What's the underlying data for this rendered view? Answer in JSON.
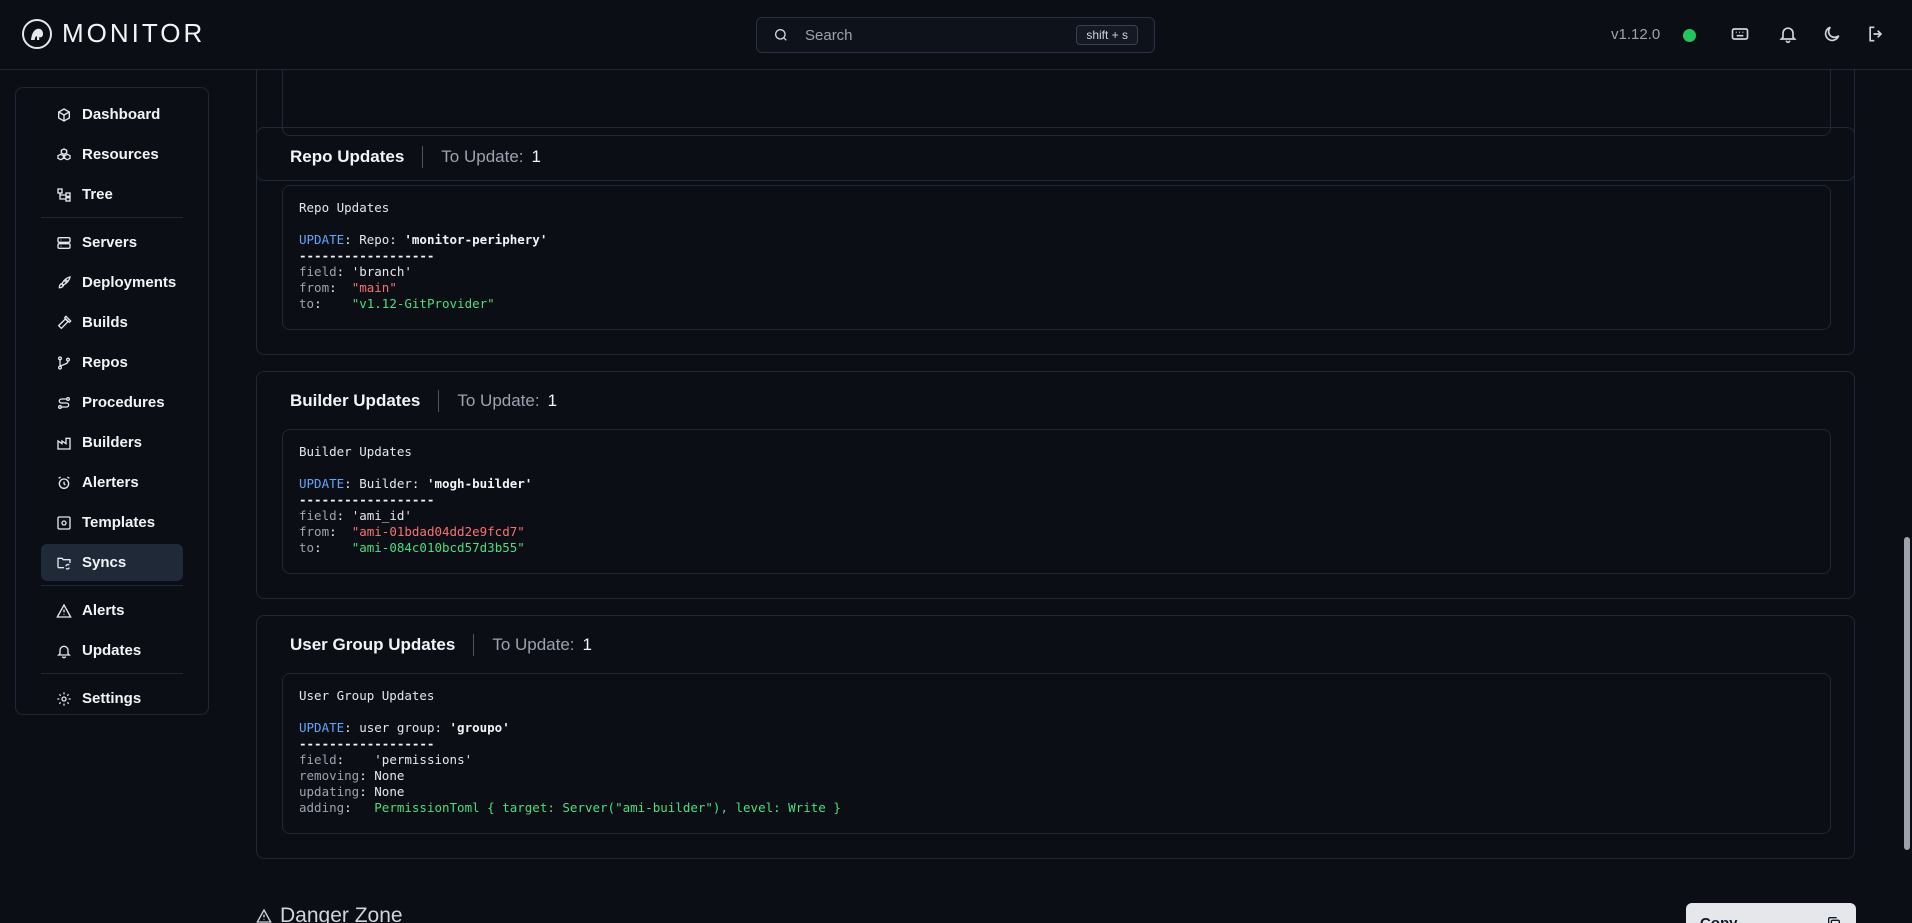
{
  "header": {
    "brand": "MONITOR",
    "search_placeholder": "Search",
    "search_shortcut": "shift + s",
    "version": "v1.12.0",
    "status_color": "#22c55e"
  },
  "sidebar": {
    "items": [
      {
        "label": "Dashboard",
        "icon": "box-icon"
      },
      {
        "label": "Resources",
        "icon": "boxes-icon"
      },
      {
        "label": "Tree",
        "icon": "tree-icon"
      },
      {
        "label": "Servers",
        "icon": "server-icon"
      },
      {
        "label": "Deployments",
        "icon": "rocket-icon"
      },
      {
        "label": "Builds",
        "icon": "hammer-icon"
      },
      {
        "label": "Repos",
        "icon": "git-branch-icon"
      },
      {
        "label": "Procedures",
        "icon": "route-icon"
      },
      {
        "label": "Builders",
        "icon": "factory-icon"
      },
      {
        "label": "Alerters",
        "icon": "alarm-icon"
      },
      {
        "label": "Templates",
        "icon": "template-icon"
      },
      {
        "label": "Syncs",
        "icon": "folder-sync-icon",
        "active": true
      },
      {
        "label": "Alerts",
        "icon": "alert-triangle-icon"
      },
      {
        "label": "Updates",
        "icon": "bell-icon"
      },
      {
        "label": "Settings",
        "icon": "gear-icon"
      }
    ]
  },
  "cards": {
    "to_update_label": "To Update:",
    "repo": {
      "title": "Repo Updates",
      "count": "1",
      "code_title": "Repo Updates",
      "update_kw": "UPDATE",
      "target_prefix": ": Repo: ",
      "target_name": "'monitor-periphery'",
      "rule": "------------------",
      "field_label": "field",
      "field_value": "'branch'",
      "from_label": "from",
      "from_value": "\"main\"",
      "to_label": "to",
      "to_value": "\"v1.12-GitProvider\""
    },
    "builder": {
      "title": "Builder Updates",
      "count": "1",
      "code_title": "Builder Updates",
      "update_kw": "UPDATE",
      "target_prefix": ": Builder: ",
      "target_name": "'mogh-builder'",
      "rule": "------------------",
      "field_label": "field",
      "field_value": "'ami_id'",
      "from_label": "from",
      "from_value": "\"ami-01bdad04dd2e9fcd7\"",
      "to_label": "to",
      "to_value": "\"ami-084c010bcd57d3b55\""
    },
    "user_group": {
      "title": "User Group Updates",
      "count": "1",
      "code_title": "User Group Updates",
      "update_kw": "UPDATE",
      "target_prefix": ": user group: ",
      "target_name": "'groupo'",
      "rule": "------------------",
      "field_label": "field",
      "field_value": "'permissions'",
      "removing_label": "removing",
      "removing_value": "None",
      "updating_label": "updating",
      "updating_value": "None",
      "adding_label": "adding",
      "adding_value": "PermissionToml { target: Server(\"ami-builder\"), level: Write }"
    }
  },
  "danger_zone": {
    "title": "Danger Zone"
  },
  "copy_button": {
    "label": "Copy"
  }
}
